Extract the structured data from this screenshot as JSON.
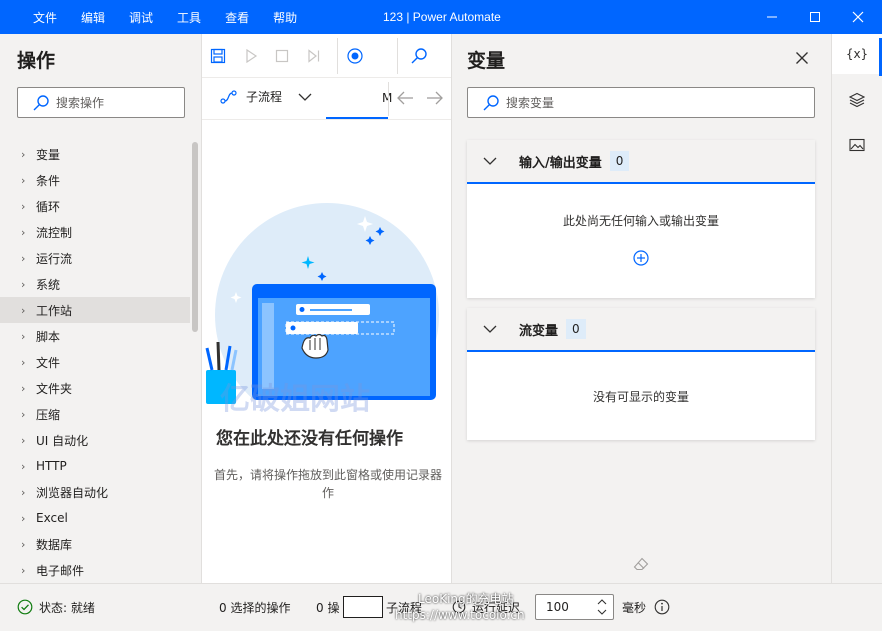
{
  "titlebar": {
    "menu": [
      "文件",
      "编辑",
      "调试",
      "工具",
      "查看",
      "帮助"
    ],
    "title": "123 | Power Automate"
  },
  "actions_panel": {
    "title": "操作",
    "search_placeholder": "搜索操作",
    "categories": [
      "变量",
      "条件",
      "循环",
      "流控制",
      "运行流",
      "系统",
      "工作站",
      "脚本",
      "文件",
      "文件夹",
      "压缩",
      "UI 自动化",
      "HTTP",
      "浏览器自动化",
      "Excel",
      "数据库",
      "电子邮件"
    ],
    "selected_category": "工作站"
  },
  "center": {
    "subflow_label": "子流程",
    "tab_main_partial": "M",
    "empty_title": "您在此处还没有任何操作",
    "empty_desc": "首先，请将操作拖放到此窗格或使用记录器 作",
    "watermark": "亿破姐网站"
  },
  "variables_panel": {
    "title": "变量",
    "search_placeholder": "搜索变量",
    "sections": [
      {
        "label": "输入/输出变量",
        "count": "0",
        "empty_text": "此处尚无任何输入或输出变量"
      },
      {
        "label": "流变量",
        "count": "0",
        "empty_text": "没有可显示的变量"
      }
    ]
  },
  "rail": {
    "variables_label": "{x}"
  },
  "statusbar": {
    "status_text": "状态: 就绪",
    "selected_actions": "0 选择的操作",
    "actions_count": "0 操",
    "subflows": "子流程",
    "run_delay_label": "运行延迟",
    "delay_value": "100",
    "delay_unit": "毫秒",
    "watermark_top": "LeoKing的充电站",
    "watermark_bottom": "https://www.tocolo.cn"
  },
  "colors": {
    "accent": "#0066ff",
    "panel_bg": "#f3f2f1",
    "count_badge": "#deecf9",
    "status_ok": "#107c10"
  }
}
